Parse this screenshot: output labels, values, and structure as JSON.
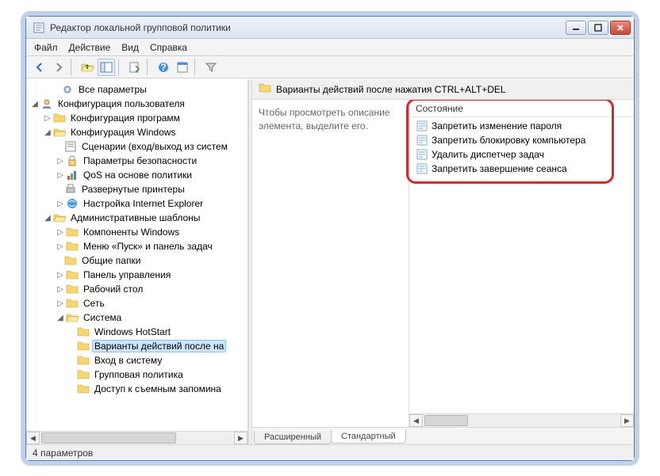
{
  "window": {
    "title": "Редактор локальной групповой политики"
  },
  "menu": {
    "file": "Файл",
    "action": "Действие",
    "view": "Вид",
    "help": "Справка"
  },
  "tree": {
    "all_params": "Все параметры",
    "user_config": "Конфигурация пользователя",
    "prog_config": "Конфигурация программ",
    "win_config": "Конфигурация Windows",
    "scripts": "Сценарии (вход/выход из систем",
    "sec_params": "Параметры безопасности",
    "qos": "QoS на основе политики",
    "printers": "Развернутые принтеры",
    "ie": "Настройка Internet Explorer",
    "admin_tmpl": "Административные шаблоны",
    "win_comp": "Компоненты Windows",
    "start_menu": "Меню «Пуск» и панель задач",
    "shared": "Общие папки",
    "control_panel": "Панель управления",
    "desktop": "Рабочий стол",
    "network": "Сеть",
    "system": "Система",
    "hotstart": "Windows HotStart",
    "cad": "Варианты действий после на",
    "logon": "Вход в систему",
    "gp": "Групповая политика",
    "removable": "Доступ к съемным запомина"
  },
  "right": {
    "header": "Варианты действий после нажатия CTRL+ALT+DEL",
    "desc": "Чтобы просмотреть описание элемента, выделите его.",
    "col_state": "Состояние",
    "items": [
      "Запретить изменение пароля",
      "Запретить блокировку компьютера",
      "Удалить диспетчер задач",
      "Запретить завершение сеанса"
    ]
  },
  "tabs": {
    "extended": "Расширенный",
    "standard": "Стандартный"
  },
  "status": "4 параметров"
}
